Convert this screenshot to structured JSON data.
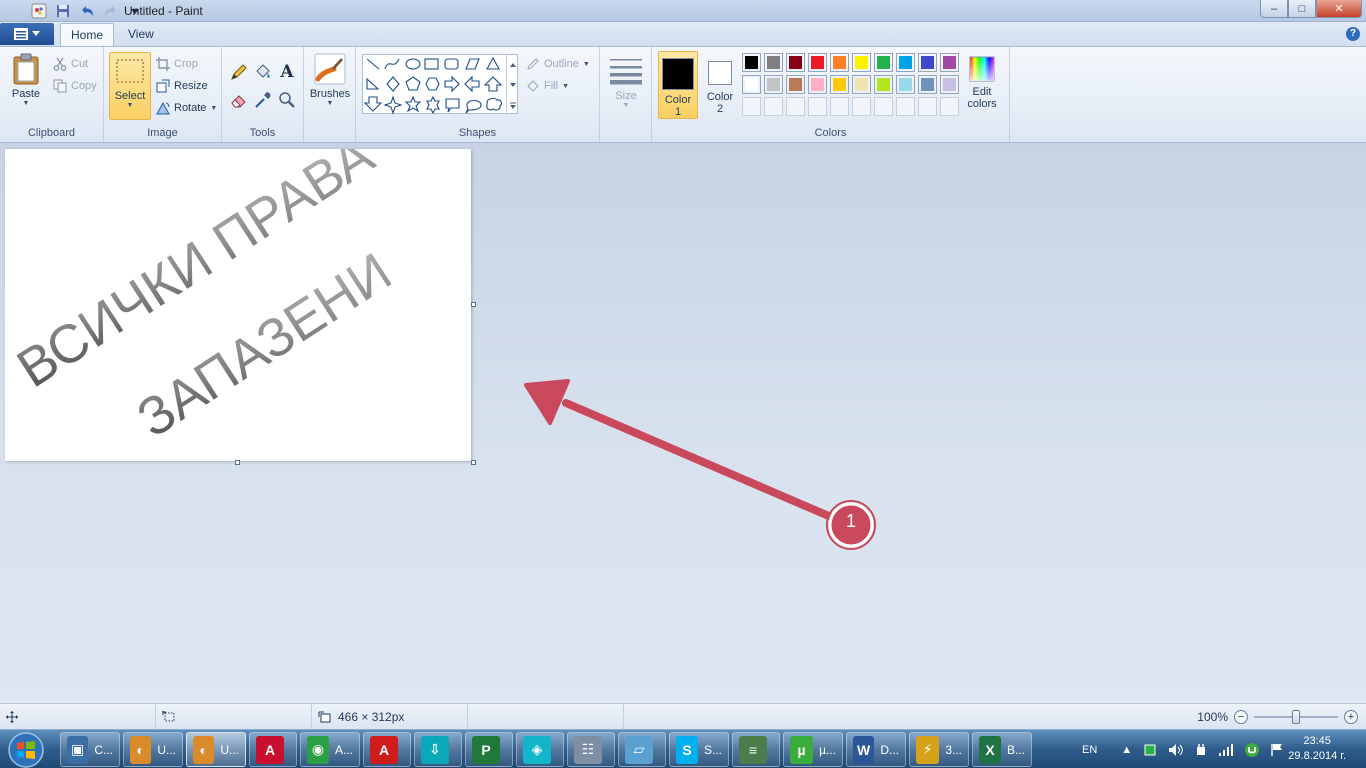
{
  "window": {
    "title": "Untitled - Paint",
    "minimize_symbol": "–",
    "maximize_symbol": "□",
    "close_symbol": "✕"
  },
  "tabs": [
    {
      "label": "Home",
      "active": true
    },
    {
      "label": "View",
      "active": false
    }
  ],
  "help_symbol": "?",
  "ribbon": {
    "clipboard": {
      "label": "Clipboard",
      "paste": "Paste",
      "cut": "Cut",
      "copy": "Copy"
    },
    "image": {
      "label": "Image",
      "select": "Select",
      "crop": "Crop",
      "resize": "Resize",
      "rotate": "Rotate"
    },
    "tools": {
      "label": "Tools",
      "text_tool_glyph": "A"
    },
    "brushes": {
      "label": "Brushes"
    },
    "shapes": {
      "label": "Shapes",
      "outline": "Outline",
      "fill": "Fill"
    },
    "size": {
      "label": "Size"
    },
    "colors": {
      "label": "Colors",
      "color1_label": "Color",
      "color1_num": "1",
      "color2_label": "Color",
      "color2_num": "2",
      "edit_colors_line1": "Edit",
      "edit_colors_line2": "colors",
      "color1_value": "#000000",
      "color2_value": "#ffffff",
      "palette_row1": [
        "#000000",
        "#7f7f7f",
        "#880015",
        "#ed1c24",
        "#ff7f27",
        "#fff200",
        "#22b14c",
        "#00a2e8",
        "#3f48cc",
        "#a349a4"
      ],
      "palette_row2": [
        "#ffffff",
        "#c3c3c3",
        "#b97a57",
        "#ffaec9",
        "#ffc90e",
        "#efe4b0",
        "#b5e61d",
        "#99d9ea",
        "#7092be",
        "#c8bfe7"
      ]
    }
  },
  "canvas": {
    "text_line1": "ВСИЧКИ ПРАВА",
    "text_line2": "ЗАПАЗЕНИ"
  },
  "annotation": {
    "number": "1",
    "color": "#c9485b"
  },
  "statusbar": {
    "dimensions": "466 × 312px",
    "zoom": "100%",
    "zoom_out": "−",
    "zoom_in": "+",
    "zoom_level_fraction": 0.5
  },
  "taskbar": {
    "items": [
      {
        "label": "C...",
        "icon": "computer-icon",
        "color": "#3a6ea5"
      },
      {
        "label": "U...",
        "icon": "paint-icon",
        "color": "#d98b2b"
      },
      {
        "label": "U...",
        "icon": "paint-icon",
        "color": "#d98b2b"
      },
      {
        "label": "",
        "icon": "autocad-icon",
        "color": "#c8102e"
      },
      {
        "label": "A...",
        "icon": "chrome-icon",
        "color": "#2c9f45"
      },
      {
        "label": "",
        "icon": "autocad-red-icon",
        "color": "#d01c1c"
      },
      {
        "label": "",
        "icon": "arrow-app-icon",
        "color": "#0aa8b8"
      },
      {
        "label": "",
        "icon": "project-icon",
        "color": "#1f7a3a"
      },
      {
        "label": "",
        "icon": "teal-app-icon",
        "color": "#12b5c9"
      },
      {
        "label": "",
        "icon": "calculator-icon",
        "color": "#7e8fa3"
      },
      {
        "label": "",
        "icon": "notes-icon",
        "color": "#5aa0d0"
      },
      {
        "label": "S...",
        "icon": "skype-icon",
        "color": "#00aff0"
      },
      {
        "label": "",
        "icon": "task-manager-icon",
        "color": "#4a7d4a"
      },
      {
        "label": "µ...",
        "icon": "utorrent-icon",
        "color": "#3bab3b"
      },
      {
        "label": "D...",
        "icon": "word-icon",
        "color": "#2b579a"
      },
      {
        "label": "3...",
        "icon": "winamp-icon",
        "color": "#d6a21a"
      },
      {
        "label": "B...",
        "icon": "excel-icon",
        "color": "#217346"
      }
    ],
    "language": "EN",
    "time": "23:45",
    "date": "29.8.2014 г."
  }
}
